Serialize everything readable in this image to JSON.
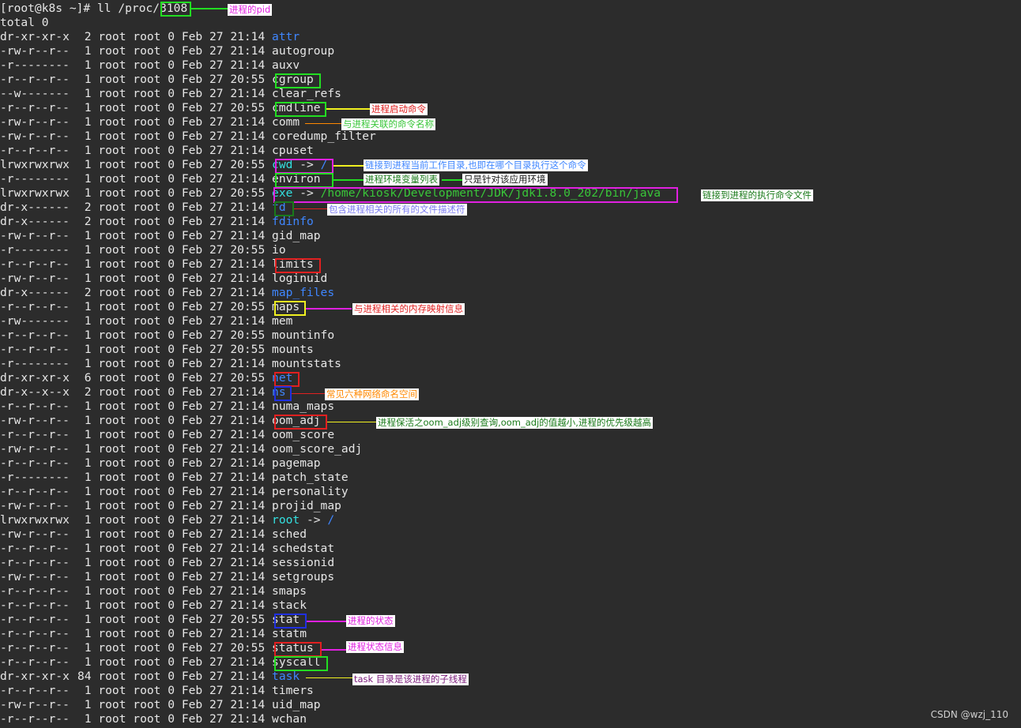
{
  "terminal": {
    "prompt": "[root@k8s ~]# ll /proc/",
    "pid": "3108",
    "total": "total 0",
    "entries": [
      {
        "perm": "dr-xr-xr-x",
        "links": " 2",
        "date": "Feb 27 21:14",
        "name": "attr",
        "color": "blue"
      },
      {
        "perm": "-rw-r--r--",
        "links": " 1",
        "date": "Feb 27 21:14",
        "name": "autogroup"
      },
      {
        "perm": "-r--------",
        "links": " 1",
        "date": "Feb 27 21:14",
        "name": "auxv"
      },
      {
        "perm": "-r--r--r--",
        "links": " 1",
        "date": "Feb 27 20:55",
        "name": "cgroup"
      },
      {
        "perm": "--w-------",
        "links": " 1",
        "date": "Feb 27 21:14",
        "name": "clear_refs"
      },
      {
        "perm": "-r--r--r--",
        "links": " 1",
        "date": "Feb 27 20:55",
        "name": "cmdline"
      },
      {
        "perm": "-rw-r--r--",
        "links": " 1",
        "date": "Feb 27 21:14",
        "name": "comm"
      },
      {
        "perm": "-rw-r--r--",
        "links": " 1",
        "date": "Feb 27 21:14",
        "name": "coredump_filter"
      },
      {
        "perm": "-r--r--r--",
        "links": " 1",
        "date": "Feb 27 21:14",
        "name": "cpuset"
      },
      {
        "perm": "lrwxrwxrwx",
        "links": " 1",
        "date": "Feb 27 20:55",
        "name": "cwd",
        "color": "cyan",
        "arrow": " -> ",
        "target": "/",
        "target_color": "blue"
      },
      {
        "perm": "-r--------",
        "links": " 1",
        "date": "Feb 27 21:14",
        "name": "environ"
      },
      {
        "perm": "lrwxrwxrwx",
        "links": " 1",
        "date": "Feb 27 20:55",
        "name": "exe",
        "color": "cyan",
        "arrow": " -> ",
        "target": "/home/kiosk/Development/JDK/jdk1.8.0_202/bin/java",
        "target_color": "green"
      },
      {
        "perm": "dr-x------",
        "links": " 2",
        "date": "Feb 27 21:14",
        "name": "fd",
        "color": "blue"
      },
      {
        "perm": "dr-x------",
        "links": " 2",
        "date": "Feb 27 21:14",
        "name": "fdinfo",
        "color": "blue"
      },
      {
        "perm": "-rw-r--r--",
        "links": " 1",
        "date": "Feb 27 21:14",
        "name": "gid_map"
      },
      {
        "perm": "-r--------",
        "links": " 1",
        "date": "Feb 27 20:55",
        "name": "io"
      },
      {
        "perm": "-r--r--r--",
        "links": " 1",
        "date": "Feb 27 21:14",
        "name": "limits"
      },
      {
        "perm": "-rw-r--r--",
        "links": " 1",
        "date": "Feb 27 21:14",
        "name": "loginuid"
      },
      {
        "perm": "dr-x------",
        "links": " 2",
        "date": "Feb 27 21:14",
        "name": "map_files",
        "color": "blue"
      },
      {
        "perm": "-r--r--r--",
        "links": " 1",
        "date": "Feb 27 20:55",
        "name": "maps"
      },
      {
        "perm": "-rw-------",
        "links": " 1",
        "date": "Feb 27 21:14",
        "name": "mem"
      },
      {
        "perm": "-r--r--r--",
        "links": " 1",
        "date": "Feb 27 20:55",
        "name": "mountinfo"
      },
      {
        "perm": "-r--r--r--",
        "links": " 1",
        "date": "Feb 27 20:55",
        "name": "mounts"
      },
      {
        "perm": "-r--------",
        "links": " 1",
        "date": "Feb 27 21:14",
        "name": "mountstats"
      },
      {
        "perm": "dr-xr-xr-x",
        "links": " 6",
        "date": "Feb 27 20:55",
        "name": "net",
        "color": "blue"
      },
      {
        "perm": "dr-x--x--x",
        "links": " 2",
        "date": "Feb 27 21:14",
        "name": "ns",
        "color": "blue"
      },
      {
        "perm": "-r--r--r--",
        "links": " 1",
        "date": "Feb 27 21:14",
        "name": "numa_maps"
      },
      {
        "perm": "-rw-r--r--",
        "links": " 1",
        "date": "Feb 27 21:14",
        "name": "oom_adj"
      },
      {
        "perm": "-r--r--r--",
        "links": " 1",
        "date": "Feb 27 21:14",
        "name": "oom_score"
      },
      {
        "perm": "-rw-r--r--",
        "links": " 1",
        "date": "Feb 27 21:14",
        "name": "oom_score_adj"
      },
      {
        "perm": "-r--r--r--",
        "links": " 1",
        "date": "Feb 27 21:14",
        "name": "pagemap"
      },
      {
        "perm": "-r--------",
        "links": " 1",
        "date": "Feb 27 21:14",
        "name": "patch_state"
      },
      {
        "perm": "-r--r--r--",
        "links": " 1",
        "date": "Feb 27 21:14",
        "name": "personality"
      },
      {
        "perm": "-rw-r--r--",
        "links": " 1",
        "date": "Feb 27 21:14",
        "name": "projid_map"
      },
      {
        "perm": "lrwxrwxrwx",
        "links": " 1",
        "date": "Feb 27 21:14",
        "name": "root",
        "color": "cyan",
        "arrow": " -> ",
        "target": "/",
        "target_color": "blue"
      },
      {
        "perm": "-rw-r--r--",
        "links": " 1",
        "date": "Feb 27 21:14",
        "name": "sched"
      },
      {
        "perm": "-r--r--r--",
        "links": " 1",
        "date": "Feb 27 21:14",
        "name": "schedstat"
      },
      {
        "perm": "-r--r--r--",
        "links": " 1",
        "date": "Feb 27 21:14",
        "name": "sessionid"
      },
      {
        "perm": "-rw-r--r--",
        "links": " 1",
        "date": "Feb 27 21:14",
        "name": "setgroups"
      },
      {
        "perm": "-r--r--r--",
        "links": " 1",
        "date": "Feb 27 21:14",
        "name": "smaps"
      },
      {
        "perm": "-r--r--r--",
        "links": " 1",
        "date": "Feb 27 21:14",
        "name": "stack"
      },
      {
        "perm": "-r--r--r--",
        "links": " 1",
        "date": "Feb 27 20:55",
        "name": "stat"
      },
      {
        "perm": "-r--r--r--",
        "links": " 1",
        "date": "Feb 27 21:14",
        "name": "statm"
      },
      {
        "perm": "-r--r--r--",
        "links": " 1",
        "date": "Feb 27 20:55",
        "name": "status"
      },
      {
        "perm": "-r--r--r--",
        "links": " 1",
        "date": "Feb 27 21:14",
        "name": "syscall"
      },
      {
        "perm": "dr-xr-xr-x",
        "links": "84",
        "date": "Feb 27 21:14",
        "name": "task",
        "color": "blue"
      },
      {
        "perm": "-r--r--r--",
        "links": " 1",
        "date": "Feb 27 21:14",
        "name": "timers"
      },
      {
        "perm": "-rw-r--r--",
        "links": " 1",
        "date": "Feb 27 21:14",
        "name": "uid_map"
      },
      {
        "perm": "-r--r--r--",
        "links": " 1",
        "date": "Feb 27 21:14",
        "name": "wchan"
      }
    ]
  },
  "annotations": {
    "pid": "进程的pid",
    "cmdline": "进程启动命令",
    "comm": "与进程关联的命令名称",
    "cwd": "链接到进程当前工作目录,也即在哪个目录执行这个命令",
    "environ": "进程环境变量列表",
    "environ_note": "只是针对该应用环境",
    "exe": "链接到进程的执行命令文件",
    "fd": "包含进程相关的所有的文件描述符",
    "maps": "与进程相关的内存映射信息",
    "ns": "常见六种网络命名空间",
    "oom_adj": "进程保活之oom_adj级别查询,oom_adj的值越小,进程的优先级越高",
    "stat": "进程的状态",
    "status": "进程状态信息",
    "task": "task 目录是该进程的子线程"
  },
  "colors": {
    "background": "#2c2c2c",
    "text": "#e6e6e6",
    "dir_blue": "#3f86ff",
    "link_cyan": "#33e0e0",
    "exec_green": "#39c639",
    "box_green": "#22dd22",
    "box_magenta": "#e020e0",
    "box_red": "#e02020",
    "box_yellow": "#f0f020",
    "box_blue": "#2030e0",
    "line_orange": "#ff8800"
  },
  "watermark": "CSDN @wzj_110"
}
